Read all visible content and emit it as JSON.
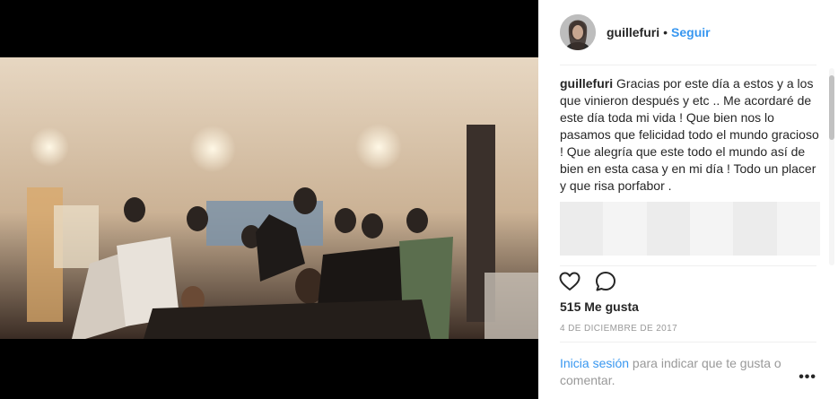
{
  "post": {
    "username": "guillefuri",
    "separator": "•",
    "follow_label": "Seguir",
    "caption_user": "guillefuri",
    "caption_text": "Gracias por este día a estos y a los que vinieron después y etc .. Me acordaré de este día toda mi vida ! Que bien nos lo pasamos que felicidad todo el mundo gracioso ! Que alegría que este todo el mundo así de bien en esta casa y en mi día ! Todo un placer y que risa porfabor .",
    "likes": "515 Me gusta",
    "date": "4 DE DICIEMBRE DE 2017",
    "login_link": "Inicia sesión",
    "login_text": " para indicar que te gusta o comentar.",
    "more_label": "•••"
  },
  "icons": {
    "like": "heart-icon",
    "comment": "comment-bubble-icon",
    "more": "ellipsis-icon"
  },
  "colors": {
    "link_blue": "#3897f0",
    "text": "#262626",
    "muted": "#999999",
    "media_bg": "#000000"
  }
}
